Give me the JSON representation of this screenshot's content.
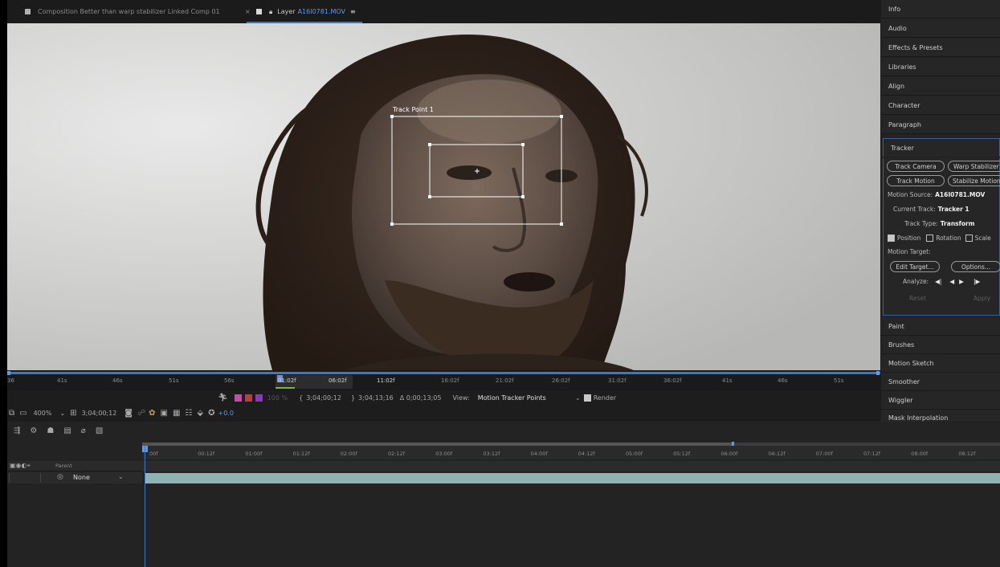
{
  "tabs": {
    "comp_tab": "Composition Better than warp stabilizer Linked Comp 01",
    "comp_close": "×",
    "layer_prefix": "Layer",
    "layer_name": "A16I0781.MOV",
    "layer_menu": "≡"
  },
  "viewer": {
    "track_point_label": "Track Point 1"
  },
  "ruler": {
    "labels": [
      "36",
      "41s",
      "46s",
      "51s",
      "56s",
      "01:02f",
      "06:02f",
      "11:02f",
      "16:02f",
      "21:02f",
      "26:02f",
      "31:02f",
      "36:02f",
      "41s",
      "46s",
      "51s"
    ]
  },
  "layer_controls": {
    "opacity": "100 %",
    "in_point": "3;04;00;12",
    "out_point": "3;04;13;16",
    "duration": "Δ 0;00;13;05",
    "view_label": "View:",
    "view_value": "Motion Tracker Points",
    "render_label": "Render"
  },
  "viewer_footer": {
    "zoom": "400%",
    "current_time": "3;04;00;12",
    "exposure": "+0.0"
  },
  "panel": {
    "items": [
      "Info",
      "Audio",
      "Effects & Presets",
      "Libraries",
      "Align",
      "Character",
      "Paragraph"
    ],
    "tracker_title": "Tracker",
    "lower_items": [
      "Paint",
      "Brushes",
      "Motion Sketch",
      "Smoother",
      "Wiggler"
    ],
    "truncated_item": "Mask Interpolation"
  },
  "tracker": {
    "track_camera": "Track Camera",
    "warp_stabilizer": "Warp Stabilizer",
    "track_motion": "Track Motion",
    "stabilize_motion": "Stabilize Motion",
    "motion_source_label": "Motion Source:",
    "motion_source_value": "A16I0781.MOV",
    "current_track_label": "Current Track:",
    "current_track_value": "Tracker 1",
    "track_type_label": "Track Type:",
    "track_type_value": "Transform",
    "position_label": "Position",
    "rotation_label": "Rotation",
    "scale_label": "Scale",
    "motion_target_label": "Motion Target:",
    "edit_target": "Edit Target...",
    "options": "Options...",
    "analyze_label": "Analyze:",
    "reset": "Reset",
    "apply": "Apply"
  },
  "timeline": {
    "parent_header": "Parent",
    "parent_value": "None",
    "ticks": [
      "00f",
      "00:12f",
      "01:00f",
      "01:12f",
      "02:00f",
      "02:12f",
      "03:00f",
      "03:12f",
      "04:00f",
      "04:12f",
      "05:00f",
      "05:12f",
      "06:00f",
      "06:12f",
      "07:00f",
      "07:12f",
      "08:00f",
      "08:12f"
    ]
  },
  "colors": {
    "accent_blue": "#3b78c9",
    "panel_bg": "#262626",
    "tracker_border": "#3c5f9c",
    "track_bar": "#8fb3b3"
  }
}
